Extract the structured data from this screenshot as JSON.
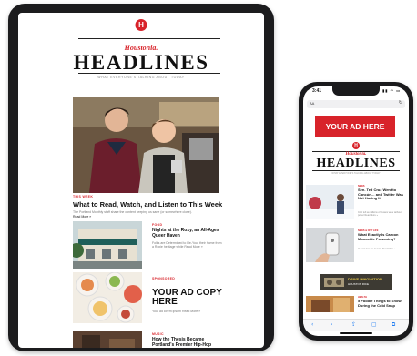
{
  "tablet": {
    "logo_letter": "H",
    "brand": "Houstonia.",
    "headline": "HEADLINES",
    "tagline": "WHAT EVERYONE'S TALKING ABOUT TODAY",
    "hero": {
      "kicker": "THIS WEEK",
      "title": "What to Read, Watch, and Listen to This Week",
      "dek": "The Portland Monthly staff share the content keeping us sane (or somewhere close).",
      "more": "Read More »"
    },
    "rows": [
      {
        "kicker": "FOOD",
        "title": "Nights at the Roxy, an All-Ages Queer Haven",
        "dek": "Folks are Determined to Re-Your their home from a Roxie heritage while Read More »"
      },
      {
        "kicker": "SPONSORED",
        "title": "YOUR AD COPY HERE",
        "dek": "Your ad lorem ipsum Read More »"
      },
      {
        "kicker": "MUSIC",
        "title": "How the Thesis Became Portland's Premier Hip-Hop"
      }
    ]
  },
  "phone": {
    "time": "3:41",
    "status": "▮▮ ◠ ▭",
    "url_aa": "AA",
    "ad_label": "YOUR AD HERE",
    "logo_letter": "H",
    "brand": "Houstonia.",
    "headline": "HEADLINES",
    "tagline": "WHAT EVERYONE'S TALKING ABOUT TODAY",
    "items": [
      {
        "kicker": "NEWS",
        "title": "Sen. Ted Cruz Went to Cancún… and Twitter Was Not Having It",
        "dek": "Cruz left as millions of Texans were without power Read More »"
      },
      {
        "kicker": "NEWS & CITY LIFE",
        "title": "What Exactly Is Carbon Monoxide Poisoning?",
        "dek": "At least two are dead in Read More »"
      },
      {
        "kicker": "HEALTH",
        "title": "5 Foodie Things to Know During the Cold Snap"
      }
    ],
    "banner": {
      "line1": "DRIVE INNOVATION",
      "line2": "HOUSTON RICE"
    },
    "toolbar": [
      "‹",
      "›",
      "⇪",
      "▢",
      "⧉"
    ]
  }
}
